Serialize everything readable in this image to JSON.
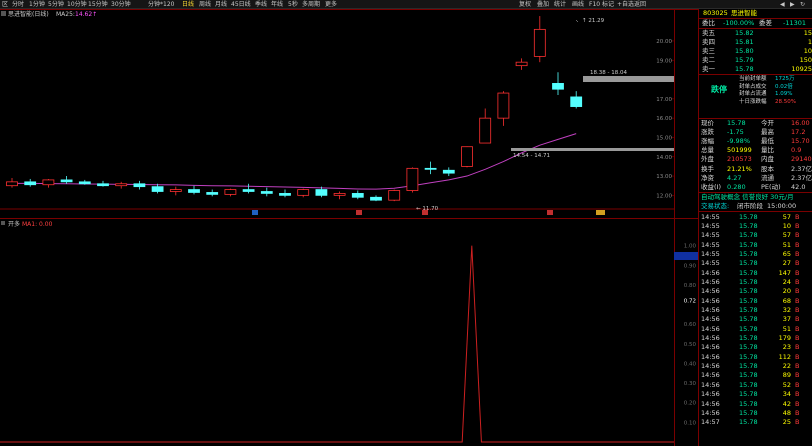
{
  "toolbar": {
    "items": [
      "区",
      "分时",
      "1分钟",
      "5分钟",
      "10分钟",
      "15分钟",
      "30分钟",
      "分钟*120",
      "日线",
      "周线",
      "月线",
      "45日线",
      "季线",
      "年线",
      "5秒",
      "多周期",
      "更多",
      "复权",
      "叠加",
      "统计",
      "画线",
      "F10",
      "标记",
      "+自选",
      "返回"
    ],
    "active": "日线"
  },
  "main_chart": {
    "legend_name": "思进智能(日线)",
    "legend_ma_label": "MA25:",
    "legend_ma_value": "14.62↑",
    "y_ticks": [
      "20.00",
      "19.00",
      "18.00",
      "17.00",
      "16.00",
      "15.00",
      "14.00",
      "13.00",
      "12.00"
    ],
    "ann_high": "21.29",
    "ann_range_top": "18.38 - 18.04",
    "ann_range_bot": "14.54 - 14.71",
    "ann_low": "11.70",
    "chart_data": {
      "type": "candlestick",
      "ylim": [
        11.5,
        21.5
      ],
      "ohlc": [
        [
          12.5,
          12.9,
          12.4,
          12.7
        ],
        [
          12.7,
          12.85,
          12.45,
          12.55
        ],
        [
          12.55,
          12.85,
          12.4,
          12.8
        ],
        [
          12.8,
          13.0,
          12.6,
          12.7
        ],
        [
          12.7,
          12.8,
          12.55,
          12.6
        ],
        [
          12.6,
          12.75,
          12.45,
          12.5
        ],
        [
          12.5,
          12.7,
          12.35,
          12.6
        ],
        [
          12.6,
          12.75,
          12.3,
          12.45
        ],
        [
          12.45,
          12.6,
          12.1,
          12.2
        ],
        [
          12.2,
          12.45,
          12.0,
          12.3
        ],
        [
          12.3,
          12.5,
          12.05,
          12.15
        ],
        [
          12.15,
          12.3,
          11.95,
          12.05
        ],
        [
          12.05,
          12.35,
          11.95,
          12.3
        ],
        [
          12.3,
          12.6,
          12.1,
          12.2
        ],
        [
          12.2,
          12.4,
          11.95,
          12.1
        ],
        [
          12.1,
          12.3,
          11.9,
          12.0
        ],
        [
          12.0,
          12.35,
          11.9,
          12.3
        ],
        [
          12.3,
          12.45,
          11.9,
          12.0
        ],
        [
          12.0,
          12.2,
          11.8,
          12.1
        ],
        [
          12.1,
          12.25,
          11.8,
          11.9
        ],
        [
          11.9,
          12.0,
          11.7,
          11.75
        ],
        [
          11.75,
          12.3,
          11.7,
          12.25
        ],
        [
          12.25,
          13.45,
          12.15,
          13.4
        ],
        [
          13.4,
          13.75,
          13.1,
          13.35
        ],
        [
          13.3,
          13.45,
          13.0,
          13.15
        ],
        [
          13.5,
          14.54,
          13.45,
          14.52
        ],
        [
          14.71,
          16.5,
          14.71,
          16.0
        ],
        [
          16.0,
          17.4,
          15.6,
          17.3
        ],
        [
          18.72,
          19.1,
          18.5,
          18.9
        ],
        [
          19.2,
          21.29,
          18.9,
          20.6
        ],
        [
          17.8,
          18.38,
          17.2,
          17.5
        ],
        [
          17.1,
          17.4,
          16.5,
          16.6
        ]
      ],
      "ma25": [
        12.62,
        12.62,
        12.61,
        12.6,
        12.59,
        12.58,
        12.57,
        12.56,
        12.55,
        12.54,
        12.52,
        12.5,
        12.49,
        12.47,
        12.45,
        12.43,
        12.41,
        12.39,
        12.36,
        12.33,
        12.32,
        12.37,
        12.5,
        12.65,
        12.8,
        13.0,
        13.35,
        13.75,
        14.2,
        14.6,
        14.9,
        15.2
      ]
    }
  },
  "sub_chart": {
    "label": "开多",
    "value_label": "MA1: 0.00",
    "y_ticks": [
      "1.00",
      "0.90",
      "0.80",
      "0.72",
      "0.60",
      "0.50",
      "0.40",
      "0.30",
      "0.20",
      "0.10"
    ],
    "chart_data": {
      "type": "line",
      "ylim": [
        0,
        1.1
      ],
      "values": [
        0,
        0,
        0,
        0,
        0,
        0,
        0,
        0,
        0,
        0,
        0,
        0,
        0,
        0,
        0,
        0,
        0,
        0,
        0,
        0,
        0,
        0,
        0,
        0,
        0,
        0,
        0,
        0,
        0,
        0,
        0,
        0,
        0,
        0,
        0,
        0,
        0,
        0,
        0,
        0,
        0,
        0,
        0,
        0,
        0,
        0,
        0,
        0,
        0,
        1,
        0,
        0,
        0,
        0,
        0,
        0,
        0,
        0,
        0,
        0,
        0,
        0,
        0,
        0,
        0,
        0,
        0,
        0,
        0,
        0,
        0
      ]
    }
  },
  "quote": {
    "code": "803025",
    "name": "思进智能",
    "top_left": "委比",
    "top_ratio": "-100.00%",
    "top_label2": "委差",
    "top_diff": "-11301",
    "asks": [
      {
        "l": "卖五",
        "p": "15.82",
        "v": "15"
      },
      {
        "l": "卖四",
        "p": "15.81",
        "v": "1"
      },
      {
        "l": "卖三",
        "p": "15.80",
        "v": "10"
      },
      {
        "l": "卖二",
        "p": "15.79",
        "v": "150"
      },
      {
        "l": "卖一",
        "p": "15.78",
        "v": "10925"
      }
    ],
    "status": "跌停",
    "seal": [
      {
        "k": "当前封单额",
        "v": "1725万"
      },
      {
        "k": "封单占成交",
        "v": "0.02倍"
      },
      {
        "k": "封单占流通",
        "v": "1.09%"
      },
      {
        "k": "十日涨跌幅",
        "v": "28.50%"
      }
    ],
    "stats": [
      [
        "现价",
        "15.78",
        "今开",
        "16.00"
      ],
      [
        "涨跌",
        "-1.75",
        "最高",
        "17.2"
      ],
      [
        "涨幅",
        "-9.98%",
        "最低",
        "15.70"
      ],
      [
        "总量",
        "501999",
        "量比",
        "0.9"
      ],
      [
        "外盘",
        "210573",
        "内盘",
        "291409"
      ],
      [
        "换手",
        "21.21%",
        "股本",
        "2.37亿"
      ],
      [
        "净资",
        "4.27",
        "流通",
        "2.37亿"
      ],
      [
        "收益(I)",
        "0.280",
        "PE(动)",
        "42.0"
      ]
    ],
    "info1": "自动驾驶概念 信誉良好 30元/月",
    "info2_label": "交易状态:",
    "info2_status": "闭市阶段",
    "info2_time": "15:00:00",
    "ticks": [
      [
        "14:55",
        "15.78",
        "57",
        "B"
      ],
      [
        "14:55",
        "15.78",
        "10",
        "B"
      ],
      [
        "14:55",
        "15.78",
        "57",
        "B"
      ],
      [
        "14:55",
        "15.78",
        "51",
        "B"
      ],
      [
        "14:55",
        "15.78",
        "65",
        "B"
      ],
      [
        "14:55",
        "15.78",
        "27",
        "B"
      ],
      [
        "14:56",
        "15.78",
        "147",
        "B"
      ],
      [
        "14:56",
        "15.78",
        "24",
        "B"
      ],
      [
        "14:56",
        "15.78",
        "20",
        "B"
      ],
      [
        "14:56",
        "15.78",
        "68",
        "B"
      ],
      [
        "14:56",
        "15.78",
        "32",
        "B"
      ],
      [
        "14:56",
        "15.78",
        "37",
        "B"
      ],
      [
        "14:56",
        "15.78",
        "51",
        "B"
      ],
      [
        "14:56",
        "15.78",
        "179",
        "B"
      ],
      [
        "14:56",
        "15.78",
        "23",
        "B"
      ],
      [
        "14:56",
        "15.78",
        "112",
        "B"
      ],
      [
        "14:56",
        "15.78",
        "22",
        "B"
      ],
      [
        "14:56",
        "15.78",
        "89",
        "B"
      ],
      [
        "14:56",
        "15.78",
        "52",
        "B"
      ],
      [
        "14:56",
        "15.78",
        "34",
        "B"
      ],
      [
        "14:56",
        "15.78",
        "42",
        "B"
      ],
      [
        "14:56",
        "15.78",
        "48",
        "B"
      ],
      [
        "14:57",
        "15.78",
        "25",
        "B"
      ]
    ]
  }
}
